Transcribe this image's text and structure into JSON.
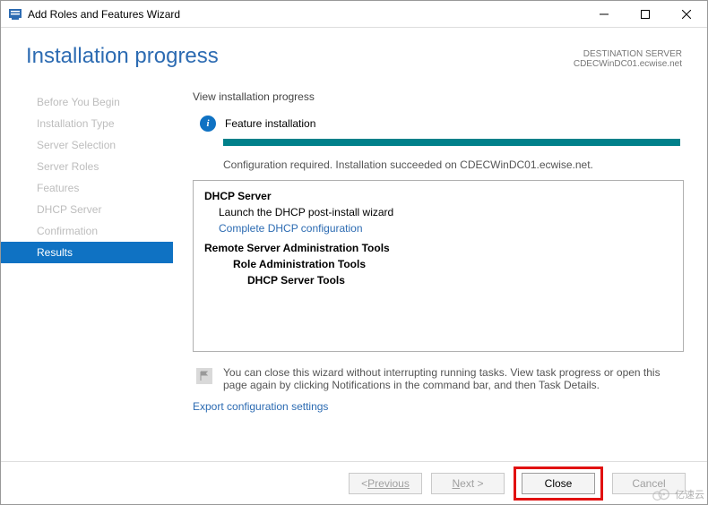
{
  "window": {
    "title": "Add Roles and Features Wizard"
  },
  "header": {
    "title": "Installation progress",
    "dest_label": "DESTINATION SERVER",
    "dest_name": "CDECWinDC01.ecwise.net"
  },
  "sidebar": {
    "items": [
      {
        "label": "Before You Begin",
        "active": false
      },
      {
        "label": "Installation Type",
        "active": false
      },
      {
        "label": "Server Selection",
        "active": false
      },
      {
        "label": "Server Roles",
        "active": false
      },
      {
        "label": "Features",
        "active": false
      },
      {
        "label": "DHCP Server",
        "active": false
      },
      {
        "label": "Confirmation",
        "active": false
      },
      {
        "label": "Results",
        "active": true
      }
    ]
  },
  "content": {
    "view_label": "View installation progress",
    "status_title": "Feature installation",
    "progress_percent": 100,
    "config_msg": "Configuration required. Installation succeeded on CDECWinDC01.ecwise.net.",
    "results": {
      "role_title": "DHCP Server",
      "role_sub": "Launch the DHCP post-install wizard",
      "role_link": "Complete DHCP configuration",
      "tools_title": "Remote Server Administration Tools",
      "tools_sub": "Role Administration Tools",
      "tools_sub2": "DHCP Server Tools"
    },
    "note": "You can close this wizard without interrupting running tasks. View task progress or open this page again by clicking Notifications in the command bar, and then Task Details.",
    "export_link": "Export configuration settings"
  },
  "footer": {
    "previous": "Previous",
    "next": "Next >",
    "close": "Close",
    "cancel": "Cancel"
  },
  "watermark": {
    "text": "亿速云"
  }
}
